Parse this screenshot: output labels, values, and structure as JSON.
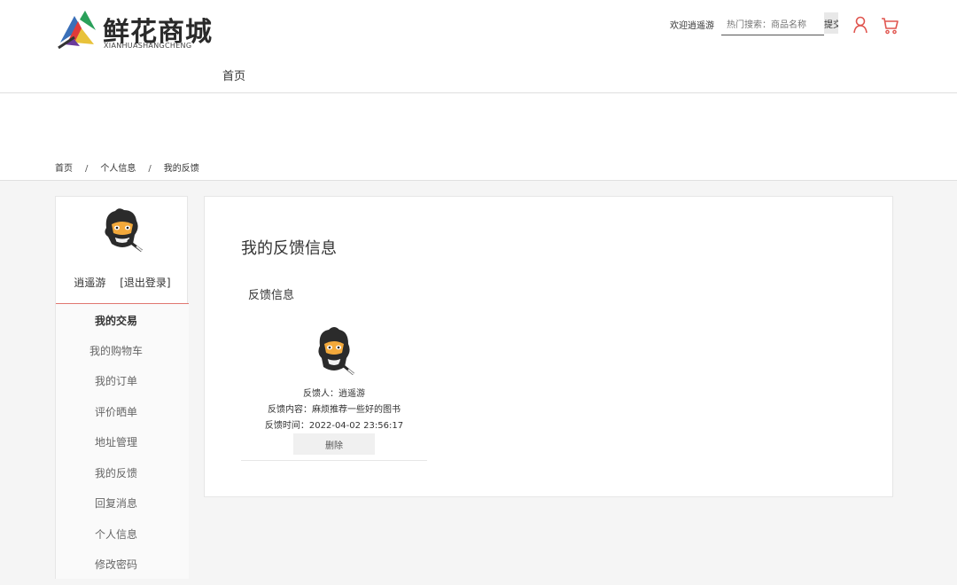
{
  "brand": {
    "title": "鲜花商城",
    "subtitle": "XIANHUASHANGCHENG"
  },
  "nav": {
    "home": "首页"
  },
  "top_bar": {
    "welcome": "欢迎逍遥游",
    "search_placeholder": "热门搜索：商品名称",
    "search_button": "提交"
  },
  "breadcrumb": {
    "items": [
      "首页",
      "个人信息",
      "我的反馈"
    ],
    "separator": "/"
  },
  "sidebar": {
    "username": "逍遥游",
    "logout": "[退出登录]",
    "menu_head": "我的交易",
    "menu": [
      "我的购物车",
      "我的订单",
      "评价晒单",
      "地址管理",
      "我的反馈",
      "回复消息",
      "个人信息",
      "修改密码"
    ]
  },
  "main": {
    "title": "我的反馈信息",
    "section": "反馈信息",
    "feedback": {
      "person": "反馈人：逍遥游",
      "content": "反馈内容：麻烦推荐一些好的图书",
      "time": "反馈时间：2022-04-02 23:56:17",
      "delete": "删除"
    }
  },
  "colors": {
    "accent_divider": "#e0766f",
    "icon_red": "#e0554f"
  }
}
